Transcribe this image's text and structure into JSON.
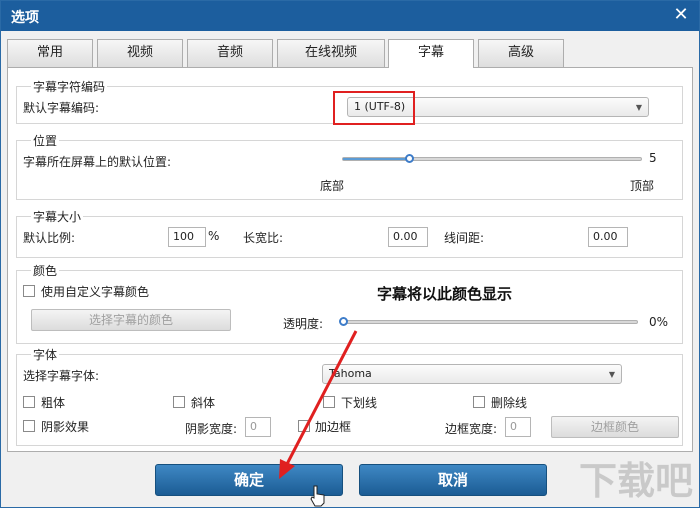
{
  "window": {
    "title": "选项"
  },
  "tabs": [
    {
      "label": "常用"
    },
    {
      "label": "视频"
    },
    {
      "label": "音频"
    },
    {
      "label": "在线视频"
    },
    {
      "label": "字幕",
      "active": true
    },
    {
      "label": "高级"
    }
  ],
  "encoding": {
    "group_label": "字幕字符编码",
    "default_label": "默认字幕编码:",
    "selected": "1 (UTF-8)"
  },
  "position": {
    "group_label": "位置",
    "label": "字幕所在屏幕上的默认位置:",
    "slider_value": 5,
    "slider_fraction": 0.22,
    "min_label": "底部",
    "max_label": "顶部"
  },
  "size": {
    "group_label": "字幕大小",
    "scale_label": "默认比例:",
    "scale_value": "100",
    "scale_unit": "%",
    "aspect_label": "长宽比:",
    "aspect_value": "0.00",
    "line_spacing_label": "线间距:",
    "line_spacing_value": "0.00"
  },
  "color": {
    "group_label": "颜色",
    "custom_label": "使用自定义字幕颜色",
    "pick_button": "选择字幕的颜色",
    "preview": "字幕将以此颜色显示",
    "transparency_label": "透明度:",
    "transparency_value": "0%",
    "transparency_fraction": 0.0
  },
  "font": {
    "group_label": "字体",
    "select_label": "选择字幕字体:",
    "selected": "Tahoma",
    "bold": "粗体",
    "italic": "斜体",
    "underline": "下划线",
    "strikethrough": "删除线",
    "shadow": "阴影效果",
    "shadow_width_label": "阴影宽度:",
    "shadow_width_value": "0",
    "border": "加边框",
    "border_width_label": "边框宽度:",
    "border_width_value": "0",
    "border_color_button": "边框颜色"
  },
  "buttons": {
    "ok": "确定",
    "cancel": "取消"
  },
  "watermark": "下载吧",
  "colors": {
    "title_bar": "#1c5e9e",
    "annotation_red": "#e02020",
    "button_blue": "#1b5c94"
  }
}
